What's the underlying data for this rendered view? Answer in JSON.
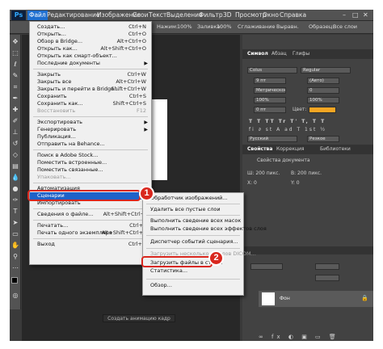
{
  "app": {
    "logo": "Ps"
  },
  "menubar": [
    "Файл",
    "Редактирование",
    "Изображение",
    "Слои",
    "Текст",
    "Выделение",
    "Фильтр",
    "3D",
    "Просмотр",
    "Окно",
    "Справка"
  ],
  "optionsbar": {
    "pressure": "Нажим:",
    "pressure_val": "100%",
    "fill": "Заливка:",
    "fill_val": "100%",
    "smooth": "Сглаживание",
    "aligned": "Выравн.",
    "sample": "Образец:",
    "sample_val": "Все слои"
  },
  "file_menu": {
    "items": [
      {
        "label": "Создать...",
        "shortcut": "Ctrl+N"
      },
      {
        "label": "Открыть...",
        "shortcut": "Ctrl+O"
      },
      {
        "label": "Обзор в Bridge...",
        "shortcut": "Alt+Ctrl+O"
      },
      {
        "label": "Открыть как...",
        "shortcut": "Alt+Shift+Ctrl+O"
      },
      {
        "label": "Открыть как смарт-объект...",
        "shortcut": ""
      },
      {
        "label": "Последние документы",
        "shortcut": ""
      },
      {
        "label": "Закрыть",
        "shortcut": "Ctrl+W"
      },
      {
        "label": "Закрыть все",
        "shortcut": "Alt+Ctrl+W"
      },
      {
        "label": "Закрыть и перейти в Bridge...",
        "shortcut": "Shift+Ctrl+W"
      },
      {
        "label": "Сохранить",
        "shortcut": "Ctrl+S"
      },
      {
        "label": "Сохранить как...",
        "shortcut": "Shift+Ctrl+S"
      },
      {
        "label": "Восстановить",
        "shortcut": "F12"
      },
      {
        "label": "Экспортировать",
        "shortcut": ""
      },
      {
        "label": "Генерировать",
        "shortcut": ""
      },
      {
        "label": "Публикация...",
        "shortcut": ""
      },
      {
        "label": "Отправить на Behance...",
        "shortcut": ""
      },
      {
        "label": "Поиск в Adobe Stock...",
        "shortcut": ""
      },
      {
        "label": "Поместить встроенные...",
        "shortcut": ""
      },
      {
        "label": "Поместить связанные...",
        "shortcut": ""
      },
      {
        "label": "Упаковать...",
        "shortcut": ""
      },
      {
        "label": "Автоматизация",
        "shortcut": ""
      },
      {
        "label": "Сценарии",
        "shortcut": ""
      },
      {
        "label": "Импортировать",
        "shortcut": ""
      },
      {
        "label": "Сведения о файле...",
        "shortcut": "Alt+Shift+Ctrl+I"
      },
      {
        "label": "Печатать...",
        "shortcut": "Ctrl+P"
      },
      {
        "label": "Печать одного экземпляра",
        "shortcut": "Alt+Shift+Ctrl+P"
      },
      {
        "label": "Выход",
        "shortcut": "Ctrl+Q"
      }
    ]
  },
  "submenu": {
    "items": [
      "Обработчик изображений...",
      "Удалить все пустые слои",
      "Выполнить сведение всех масок",
      "Выполнить сведение всех эффектов слоя",
      "Диспетчер событий сценария...",
      "Загрузить несколько файлов DICOM...",
      "Загрузить файлы в стек...",
      "Статистика...",
      "Обзор..."
    ]
  },
  "panel": {
    "tabs": [
      "Символ",
      "Абзац",
      "Глифы"
    ],
    "font": "Colus",
    "style": "Regular",
    "size": "9 пт",
    "leading": "(Авто)",
    "kerning": "Метрическое",
    "tracking": "0",
    "scale_v": "100%",
    "scale_h": "100%",
    "baseline": "0 пт",
    "color_label": "Цвет:",
    "color": "#f5a623",
    "language": "Русский",
    "aa": "Резкое",
    "props_tabs": [
      "Свойства",
      "Коррекция",
      "Библиотеки"
    ],
    "doc_props": "Свойства документа",
    "w": "Ш: 200 пикс.",
    "h": "В: 200 пикс.",
    "x": "X: 0",
    "y": "Y: 0",
    "layer": "Фон"
  },
  "canvas": {
    "status": "Создать анимацию кадр"
  },
  "annotations": {
    "badge1": "1",
    "badge2": "2"
  }
}
